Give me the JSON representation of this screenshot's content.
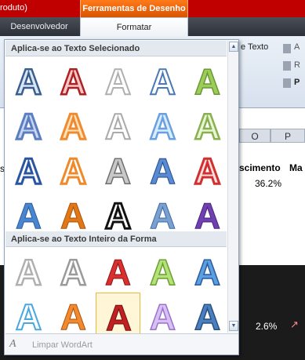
{
  "title_bar": {
    "left_text": "roduto)",
    "context_tab": "Ferramentas de Desenho"
  },
  "tabs": [
    {
      "label": "Desenvolvedor"
    },
    {
      "label": "Formatar",
      "active": true
    }
  ],
  "ribbon": {
    "texts": [
      "e Texto",
      "A",
      "R",
      "P"
    ]
  },
  "sheet": {
    "col_o": "O",
    "col_p": "P",
    "header_crescimento": "scimento",
    "header_ma": "Ma",
    "value_pct": "36.2%",
    "value_left": "s",
    "dark_value": "2.6%"
  },
  "gallery": {
    "section1_title": "Aplica-se ao Texto Selecionado",
    "section2_title": "Aplica-se ao Texto Inteiro da Forma",
    "clear_label": "Limpar WordArt",
    "scroll_up": "▲",
    "scroll_down": "▼",
    "letter": "A"
  }
}
